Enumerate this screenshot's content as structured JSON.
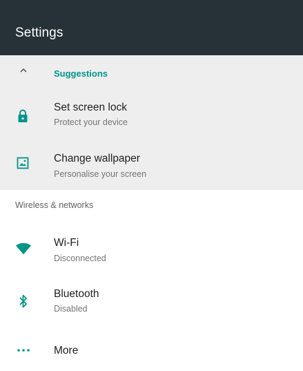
{
  "appbar": {
    "title": "Settings"
  },
  "suggestions": {
    "header": "Suggestions",
    "collapse_icon": "chevron-up-icon",
    "items": [
      {
        "title": "Set screen lock",
        "subtitle": "Protect your device",
        "icon": "lock-icon"
      },
      {
        "title": "Change wallpaper",
        "subtitle": "Personalise your screen",
        "icon": "wallpaper-icon"
      }
    ]
  },
  "section": {
    "header": "Wireless & networks",
    "items": [
      {
        "title": "Wi-Fi",
        "subtitle": "Disconnected",
        "icon": "wifi-icon"
      },
      {
        "title": "Bluetooth",
        "subtitle": "Disabled",
        "icon": "bluetooth-icon"
      },
      {
        "title": "More",
        "icon": "more-horiz-icon"
      }
    ]
  },
  "colors": {
    "appbar": "#263238",
    "accent": "#009688",
    "suggestion_bg": "#eeeeee",
    "title_text": "#212121",
    "subtitle_text": "#757575"
  }
}
